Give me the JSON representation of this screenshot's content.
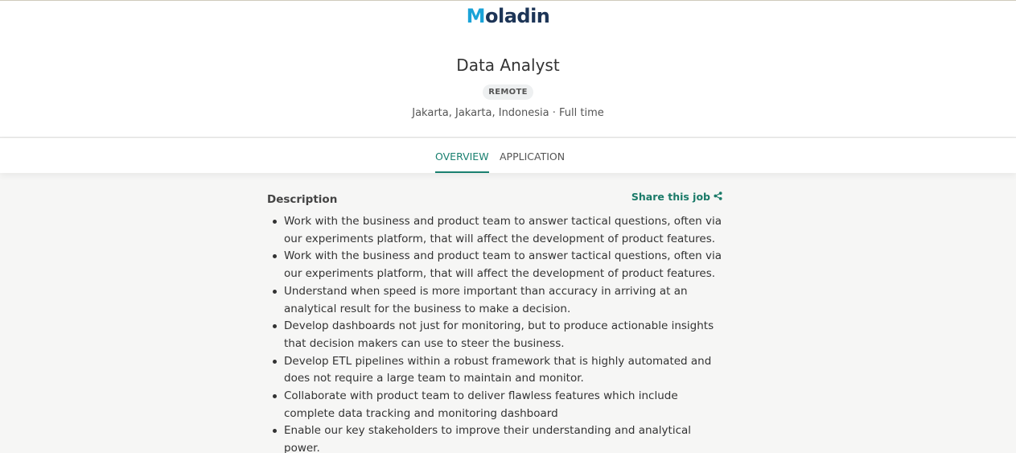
{
  "brand": {
    "logo_prefix": "M",
    "logo_rest": "oladin",
    "colors": {
      "accent": "#1a8070",
      "logo_blue": "#1aa3d8",
      "logo_navy": "#1d3557"
    }
  },
  "job": {
    "title": "Data Analyst",
    "badge": "REMOTE",
    "meta": "Jakarta, Jakarta, Indonesia · Full time"
  },
  "tabs": [
    {
      "label": "OVERVIEW",
      "active": true
    },
    {
      "label": "APPLICATION",
      "active": false
    }
  ],
  "description": {
    "heading": "Description",
    "share_label": "Share this job",
    "share_icon": "share-icon",
    "bullets": [
      "Work with the business and product team to answer tactical questions, often via our experiments platform, that will affect the development of product features.",
      "Work with the business and product team to answer tactical questions, often via our experiments platform, that will affect the development of product features.",
      "Understand when speed is more important than accuracy in arriving at an analytical result for the business to make a decision.",
      "Develop dashboards not just for monitoring, but to produce actionable insights that decision makers can use to steer the business.",
      "Develop ETL pipelines within a robust framework that is highly automated and does not require a large team to maintain and monitor.",
      "Collaborate with product team to deliver flawless features which include complete data tracking and monitoring dashboard",
      "Enable our key stakeholders to improve their understanding and analytical power."
    ]
  }
}
